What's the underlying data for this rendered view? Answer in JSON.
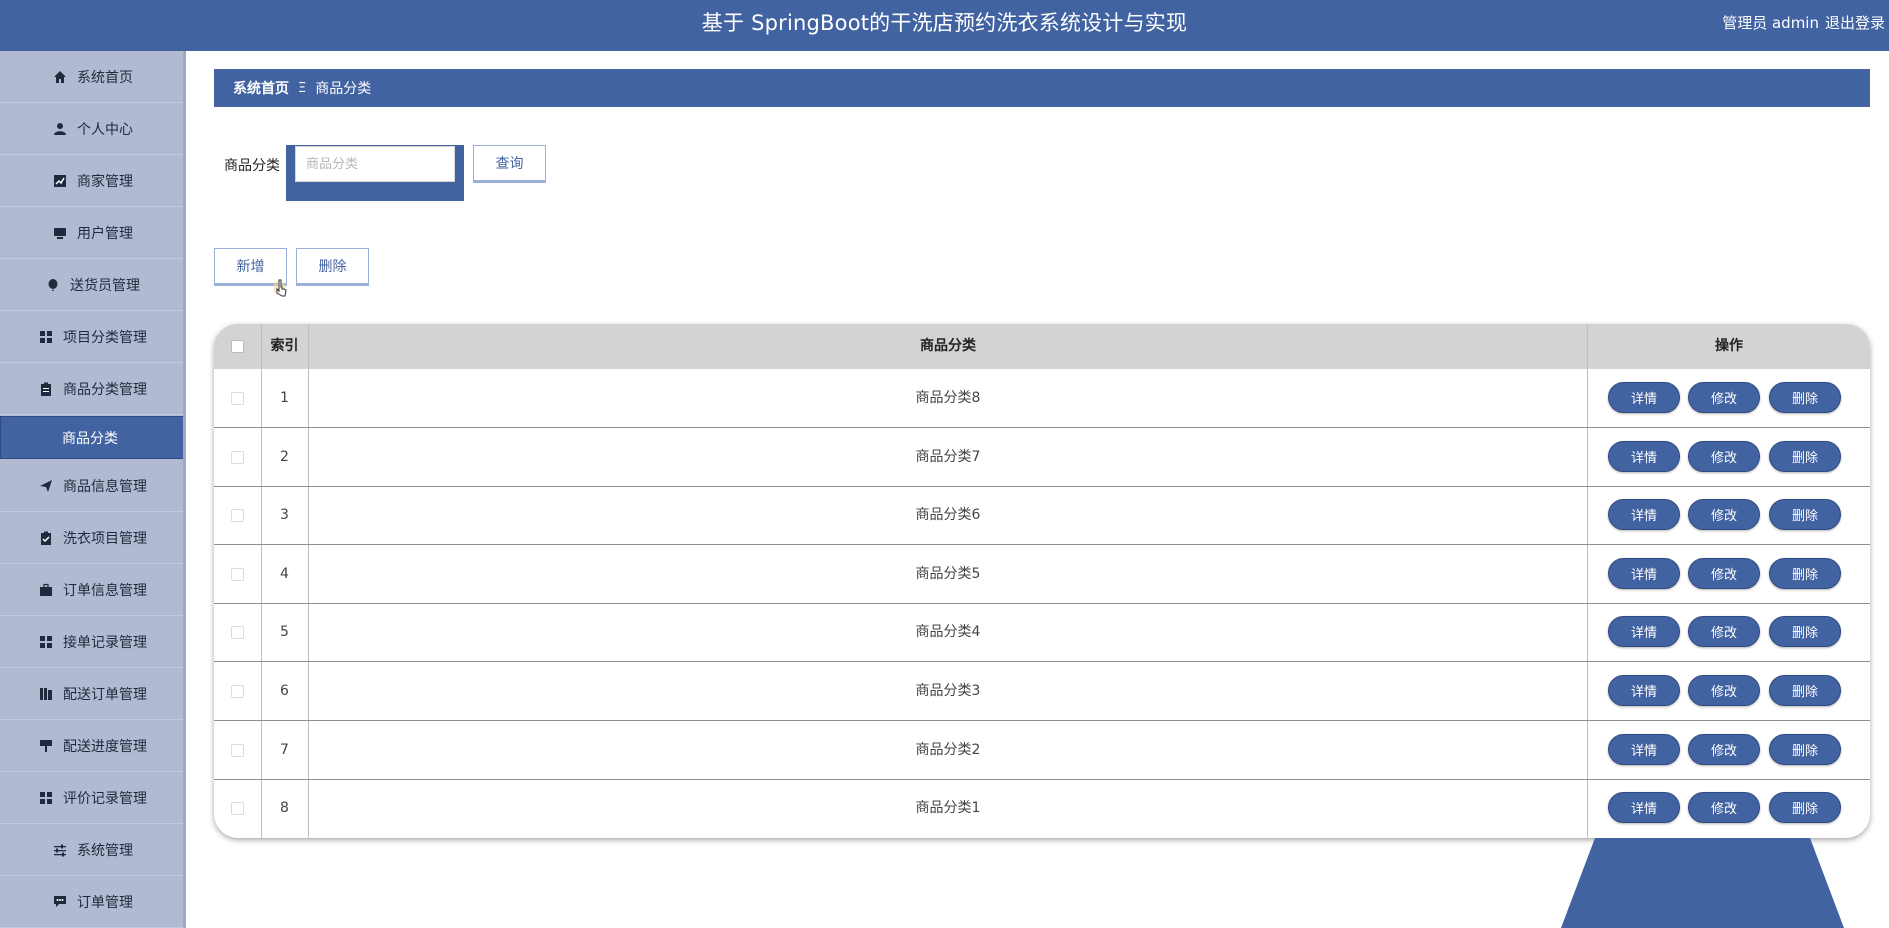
{
  "header": {
    "title": "基于 SpringBoot的干洗店预约洗衣系统设计与实现",
    "user": "管理员 admin",
    "logout": "退出登录"
  },
  "sidebar": {
    "items": [
      {
        "label": "系统首页",
        "icon": "home-icon"
      },
      {
        "label": "个人中心",
        "icon": "person-icon"
      },
      {
        "label": "商家管理",
        "icon": "chart-icon"
      },
      {
        "label": "用户管理",
        "icon": "desktop-icon"
      },
      {
        "label": "送货员管理",
        "icon": "balloon-icon"
      },
      {
        "label": "项目分类管理",
        "icon": "grid-icon"
      },
      {
        "label": "商品分类管理",
        "icon": "clipboard-icon"
      },
      {
        "label": "商品分类",
        "icon": ""
      },
      {
        "label": "商品信息管理",
        "icon": "send-icon"
      },
      {
        "label": "洗衣项目管理",
        "icon": "clipboard-check-icon"
      },
      {
        "label": "订单信息管理",
        "icon": "briefcase-icon"
      },
      {
        "label": "接单记录管理",
        "icon": "grid-icon"
      },
      {
        "label": "配送订单管理",
        "icon": "book-icon"
      },
      {
        "label": "配送进度管理",
        "icon": "signpost-icon"
      },
      {
        "label": "评价记录管理",
        "icon": "grid-icon"
      },
      {
        "label": "系统管理",
        "icon": "sliders-icon"
      },
      {
        "label": "订单管理",
        "icon": "chat-icon"
      }
    ],
    "active_index": 7
  },
  "breadcrumb": {
    "home": "系统首页",
    "separator": "Ξ",
    "current": "商品分类"
  },
  "search": {
    "label": "商品分类",
    "placeholder": "商品分类",
    "value": "",
    "query_button": "查询"
  },
  "actions": {
    "add_button": "新增",
    "delete_button": "删除"
  },
  "table": {
    "columns": {
      "index": "索引",
      "category": "商品分类",
      "operations": "操作"
    },
    "rows": [
      {
        "index": "1",
        "category": "商品分类8"
      },
      {
        "index": "2",
        "category": "商品分类7"
      },
      {
        "index": "3",
        "category": "商品分类6"
      },
      {
        "index": "4",
        "category": "商品分类5"
      },
      {
        "index": "5",
        "category": "商品分类4"
      },
      {
        "index": "6",
        "category": "商品分类3"
      },
      {
        "index": "7",
        "category": "商品分类2"
      },
      {
        "index": "8",
        "category": "商品分类1"
      }
    ],
    "row_buttons": {
      "detail": "详情",
      "edit": "修改",
      "delete": "删除"
    }
  },
  "colors": {
    "primary": "#4263a2",
    "sidebar_bg": "#b1bad1",
    "table_header_bg": "#d3d3d3"
  }
}
